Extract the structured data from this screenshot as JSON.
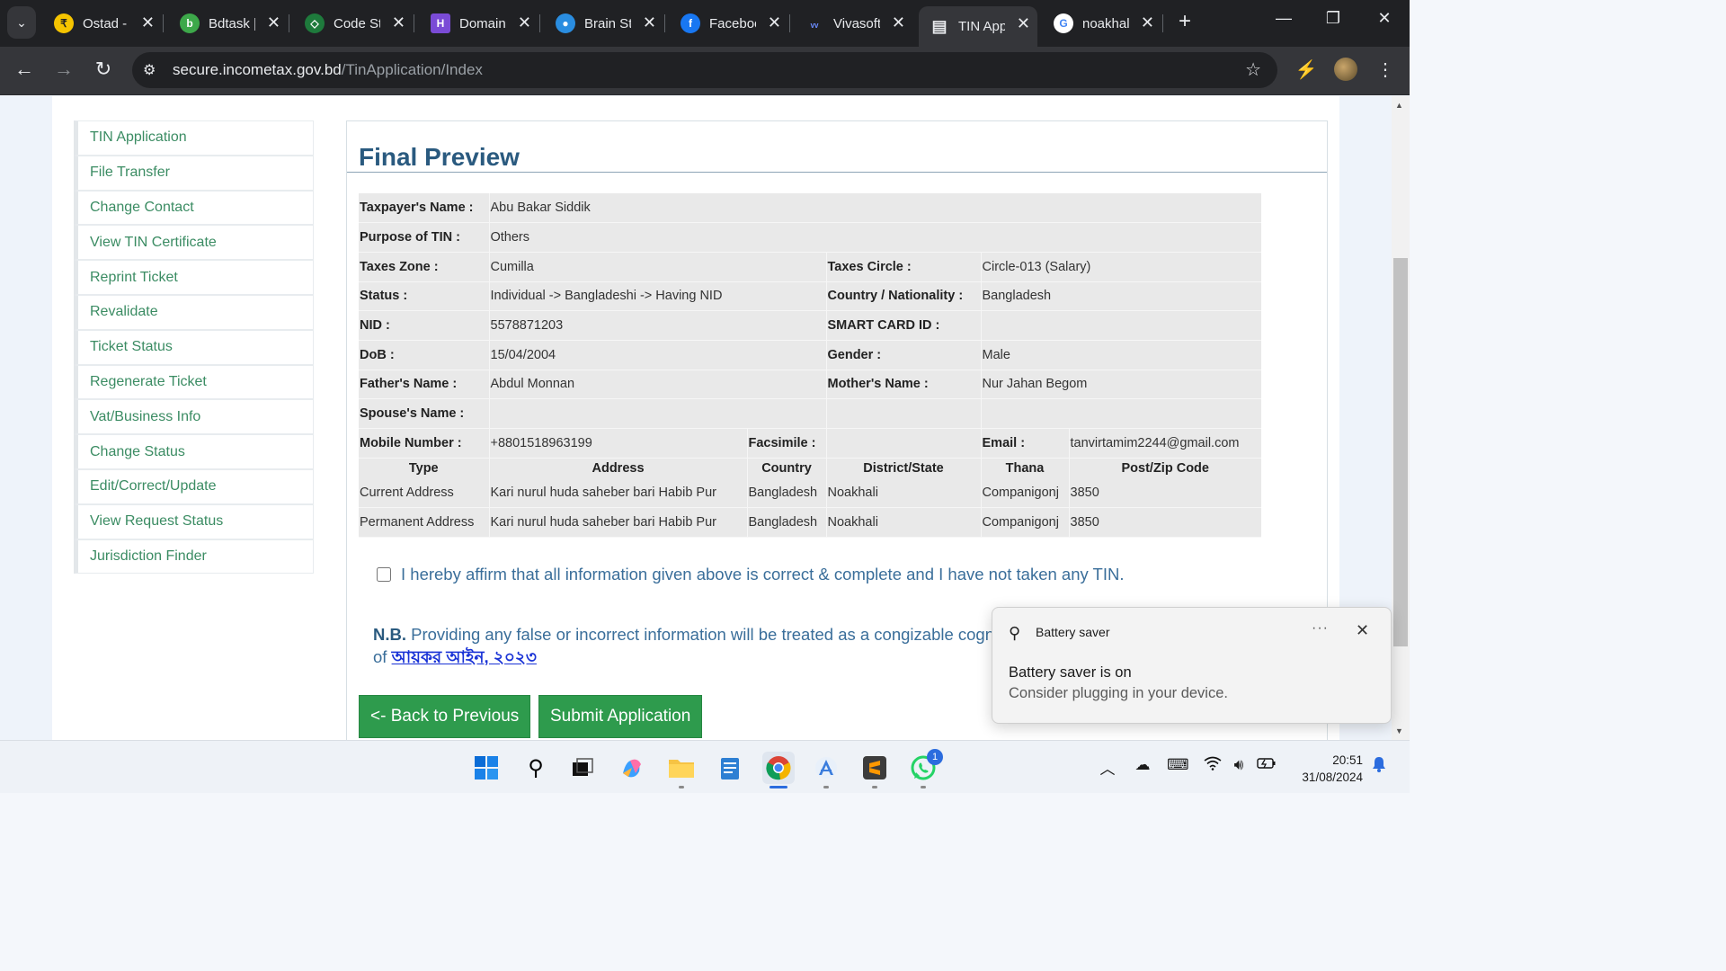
{
  "browser": {
    "tabs": [
      {
        "title": "Ostad -",
        "color": "#f5c400",
        "icon": "ostad-favicon"
      },
      {
        "title": "Bdtask |",
        "color": "#3da84a",
        "icon": "bdtask-favicon"
      },
      {
        "title": "Code St",
        "color": "#1e7a3c",
        "icon": "codestudio-favicon"
      },
      {
        "title": "Domain",
        "color": "#7a4bd6",
        "icon": "domain-favicon"
      },
      {
        "title": "Brain St",
        "color": "#2a8de0",
        "icon": "brainstation-favicon"
      },
      {
        "title": "Faceboo",
        "color": "#1877f2",
        "icon": "facebook-favicon"
      },
      {
        "title": "Vivasoft",
        "color": "#3b5bdb",
        "icon": "vivasoft-favicon"
      },
      {
        "title": "TIN App",
        "color": "#e8eaed",
        "icon": "document-favicon"
      },
      {
        "title": "noakhal",
        "color": "#ffffff",
        "icon": "google-favicon"
      }
    ],
    "active_tab_index": 7,
    "url_domain": "secure.incometax.gov.bd",
    "url_path": "/TinApplication/Index"
  },
  "sidebar": {
    "items": [
      {
        "label": "TIN Application"
      },
      {
        "label": "File Transfer"
      },
      {
        "label": "Change Contact"
      },
      {
        "label": "View TIN Certificate"
      },
      {
        "label": "Reprint Ticket"
      },
      {
        "label": "Revalidate"
      },
      {
        "label": "Ticket Status"
      },
      {
        "label": "Regenerate Ticket"
      },
      {
        "label": "Vat/Business Info"
      },
      {
        "label": "Change Status"
      },
      {
        "label": "Edit/Correct/Update"
      },
      {
        "label": "View Request Status"
      },
      {
        "label": "Jurisdiction Finder"
      }
    ]
  },
  "preview": {
    "title": "Final Preview",
    "taxpayer_name_label": "Taxpayer's Name :",
    "taxpayer_name": "Abu Bakar Siddik",
    "purpose_label": "Purpose of TIN :",
    "purpose": "Others",
    "zone_label": "Taxes Zone :",
    "zone": "Cumilla",
    "circle_label": "Taxes Circle :",
    "circle": "Circle-013 (Salary)",
    "status_label": "Status :",
    "status": "Individual -> Bangladeshi -> Having NID",
    "nationality_label": "Country / Nationality :",
    "nationality": "Bangladesh",
    "nid_label": "NID :",
    "nid": "5578871203",
    "smart_card_label": "SMART CARD ID :",
    "smart_card": "",
    "dob_label": "DoB :",
    "dob": "15/04/2004",
    "gender_label": "Gender :",
    "gender": "Male",
    "father_label": "Father's Name :",
    "father": "Abdul Monnan",
    "mother_label": "Mother's Name :",
    "mother": "Nur Jahan Begom",
    "spouse_label": "Spouse's Name :",
    "spouse": "",
    "mobile_label": "Mobile Number :",
    "mobile": "+8801518963199",
    "fax_label": "Facsimile :",
    "fax": "",
    "email_label": "Email :",
    "email": "tanvirtamim2244@gmail.com",
    "address_headers": [
      "Type",
      "Address",
      "Country",
      "District/State",
      "Thana",
      "Post/Zip Code"
    ],
    "addresses": [
      [
        "Current Address",
        "Kari nurul huda saheber bari Habib Pur",
        "Bangladesh",
        "Noakhali",
        "Companigonj",
        "3850"
      ],
      [
        "Permanent Address",
        "Kari nurul huda saheber bari Habib Pur",
        "Bangladesh",
        "Noakhali",
        "Companigonj",
        "3850"
      ]
    ]
  },
  "affirm_text": "I hereby affirm that all information given above is correct & complete and I have not taken any TIN.",
  "nb": {
    "prefix": "N.B.",
    "text": "Providing any false or incorrect information will be treated as a congizable cogni",
    "of": "of",
    "law_link": "আয়কর আইন, ২০২৩"
  },
  "buttons": {
    "back": "<- Back to Previous",
    "submit": "Submit Application"
  },
  "toast": {
    "app": "Battery saver",
    "more": "···",
    "title": "Battery saver is on",
    "body": "Consider plugging in your device."
  },
  "taskbar": {
    "time": "20:51",
    "date": "31/08/2024",
    "whatsapp_badge": "1"
  }
}
